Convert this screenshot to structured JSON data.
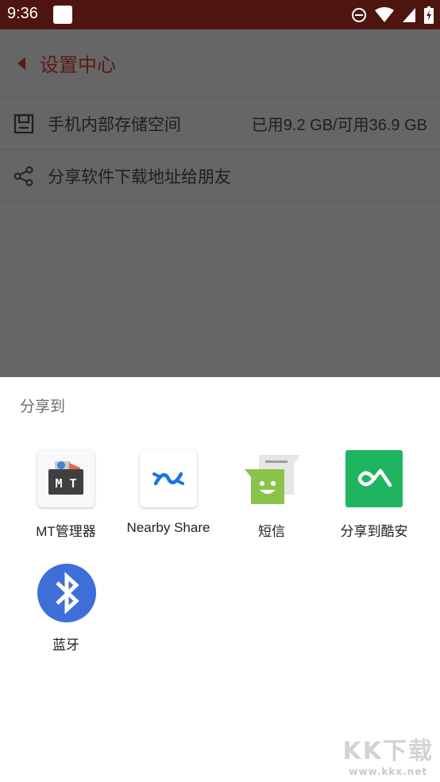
{
  "status_bar": {
    "time": "9:36",
    "icons": [
      "do-not-disturb-icon",
      "wifi-icon",
      "cell-signal-icon",
      "battery-charging-icon"
    ]
  },
  "app": {
    "title": "设置中心",
    "rows": [
      {
        "icon": "storage-icon",
        "label": "手机内部存储空间",
        "value": "已用9.2 GB/可用36.9 GB"
      },
      {
        "icon": "share-icon",
        "label": "分享软件下载地址给朋友"
      }
    ],
    "colors": {
      "status_bar": "#4e1510",
      "title": "#5a1a14",
      "scrim_bg": "#666666"
    }
  },
  "share_sheet": {
    "title": "分享到",
    "targets": [
      {
        "label": "MT管理器",
        "icon": "mt-manager-icon"
      },
      {
        "label": "Nearby Share",
        "icon": "nearby-share-icon"
      },
      {
        "label": "短信",
        "icon": "messaging-icon"
      },
      {
        "label": "分享到酷安",
        "icon": "coolapk-icon"
      },
      {
        "label": "蓝牙",
        "icon": "bluetooth-icon"
      }
    ],
    "colors": {
      "coolapk": "#1fb45f",
      "bluetooth": "#3e6fd8",
      "nearby": "#1a73e8",
      "messaging": "#8bc34a"
    }
  },
  "watermark": {
    "main": "KK下载",
    "url": "www.kkx.net"
  }
}
